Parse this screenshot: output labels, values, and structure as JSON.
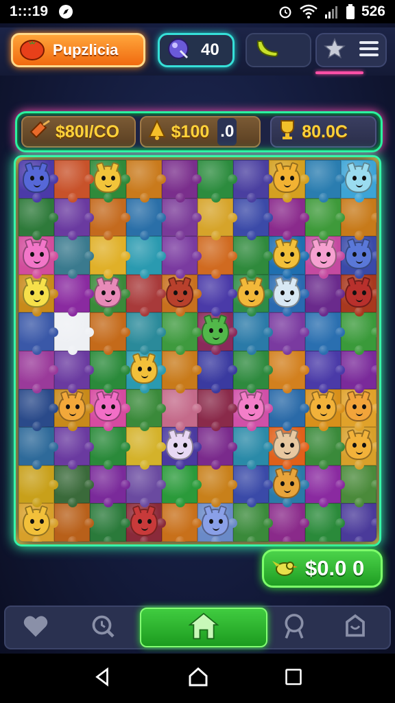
{
  "status_bar": {
    "time": "1:::19",
    "battery": "526"
  },
  "hud": {
    "brand_label": "Pupzlicia",
    "gem_value": "40"
  },
  "score_strip": {
    "chip_a": "$80I/CO",
    "chip_b": "$100",
    "chip_b_suffix": ".0",
    "chip_c": "80.0C"
  },
  "reward": {
    "value": "$0.0 0"
  },
  "colors": {
    "accent_green": "#37f5a8",
    "accent_pink": "#ff4fa6",
    "orange": "#f06a10",
    "teal": "#36e0d8"
  },
  "board": {
    "rows": 10,
    "cols": 10,
    "tiles": [
      "#4b3aa8",
      "#c8522a",
      "#2f8a3a",
      "#c97a1c",
      "#7a2e8c",
      "#2c8c3e",
      "#4a3fa0",
      "#d4a020",
      "#2a7db0",
      "#3da4d6",
      "#2e7a3a",
      "#6a3aa0",
      "#c46a1e",
      "#2a6fa8",
      "#7a3a98",
      "#d6a42a",
      "#3b4aa8",
      "#8a2a8c",
      "#3e9a3a",
      "#c77a1a",
      "#d24d9c",
      "#3a7a8e",
      "#e0b028",
      "#2a9ab0",
      "#7a3aa0",
      "#d06a20",
      "#2f8a3c",
      "#1f6fb0",
      "#c44aa0",
      "#3a4aa8",
      "#c88a1a",
      "#8a2aa0",
      "#3a8a3a",
      "#a83a3a",
      "#c8701e",
      "#4a3aa8",
      "#2e8c46",
      "#2a6ab0",
      "#6a2a8c",
      "#a8381e",
      "#3a58a8",
      "#eef0f4",
      "#c46a1a",
      "#2a8a9a",
      "#3e9a3e",
      "#8a2a5a",
      "#2a7aa8",
      "#7a3aa0",
      "#2a6fb0",
      "#3a9a3a",
      "#9a3a9a",
      "#6a3aa0",
      "#2a8a3a",
      "#2a9ab0",
      "#c87a1a",
      "#3a3aa0",
      "#2e8a3e",
      "#d2801e",
      "#4a3aa8",
      "#7a2a9a",
      "#2a4a8a",
      "#c88a1a",
      "#d64aa0",
      "#3a8a3a",
      "#c46a8a",
      "#8a2a4a",
      "#d050a8",
      "#2a6aa8",
      "#d8901a",
      "#e0a22a",
      "#2e6a9a",
      "#6a3aa0",
      "#2a8a3a",
      "#d4b22a",
      "#4a3aa0",
      "#7a2a8c",
      "#2a8aa8",
      "#e0601a",
      "#3a8a3a",
      "#d8a02a",
      "#c8a01a",
      "#3a6a3a",
      "#7a2a9a",
      "#6a4aa0",
      "#2a9a3a",
      "#c8801a",
      "#3a4aa8",
      "#2a7aa8",
      "#8a2aa0",
      "#4a8a3a",
      "#d8a02a",
      "#b8601a",
      "#2a7a3a",
      "#8a2a3a",
      "#c8701a",
      "#6a8ac8",
      "#3a8a3a",
      "#8a2a8a",
      "#2a8a3a",
      "#4a3a9a"
    ],
    "creatures": [
      {
        "i": 0,
        "c": "#5668d8"
      },
      {
        "i": 2,
        "c": "#f2c43a"
      },
      {
        "i": 7,
        "c": "#f2b232"
      },
      {
        "i": 9,
        "c": "#9adcf0"
      },
      {
        "i": 20,
        "c": "#f276c8"
      },
      {
        "i": 27,
        "c": "#f2c03a"
      },
      {
        "i": 28,
        "c": "#f6a0d0"
      },
      {
        "i": 29,
        "c": "#5a78d8"
      },
      {
        "i": 30,
        "c": "#f6e04a"
      },
      {
        "i": 32,
        "c": "#e88ab8"
      },
      {
        "i": 34,
        "c": "#b8402c"
      },
      {
        "i": 36,
        "c": "#f2b83a"
      },
      {
        "i": 37,
        "c": "#d8e8f4"
      },
      {
        "i": 39,
        "c": "#b8302c"
      },
      {
        "i": 45,
        "c": "#52b84a"
      },
      {
        "i": 53,
        "c": "#f2c03a"
      },
      {
        "i": 61,
        "c": "#f2a83a"
      },
      {
        "i": 62,
        "c": "#f26ec6"
      },
      {
        "i": 66,
        "c": "#f47ec8"
      },
      {
        "i": 68,
        "c": "#f2b23a"
      },
      {
        "i": 69,
        "c": "#f2a43a"
      },
      {
        "i": 74,
        "c": "#e8d8f4"
      },
      {
        "i": 77,
        "c": "#e8c8a0"
      },
      {
        "i": 79,
        "c": "#f2b23a"
      },
      {
        "i": 87,
        "c": "#e8a43a"
      },
      {
        "i": 90,
        "c": "#f2c03a"
      },
      {
        "i": 93,
        "c": "#c83a3a"
      },
      {
        "i": 95,
        "c": "#8aa0e8"
      }
    ]
  }
}
